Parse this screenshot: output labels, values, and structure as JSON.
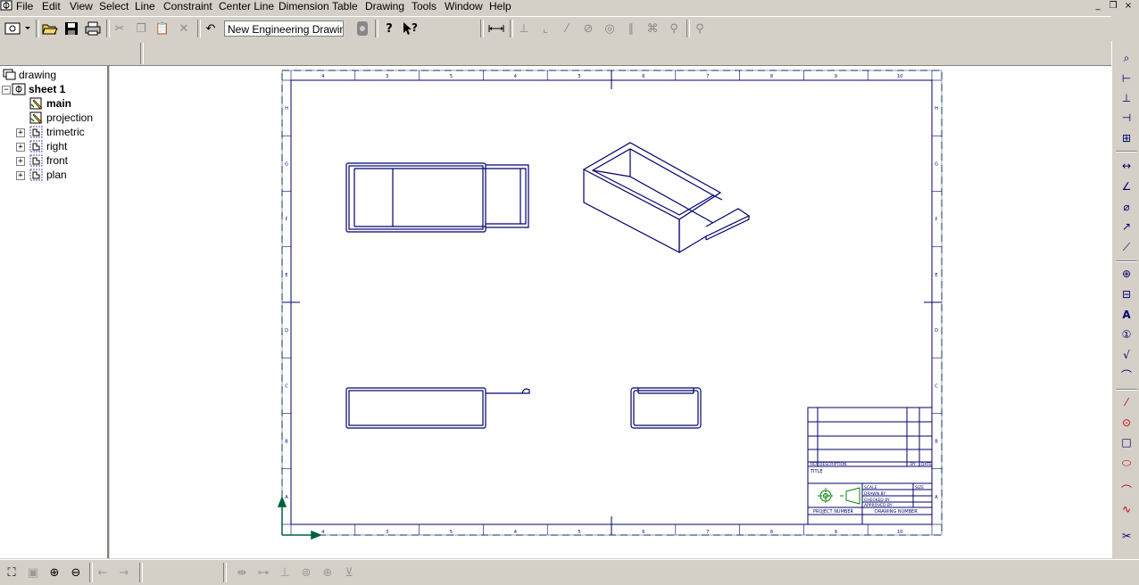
{
  "menu": {
    "items": [
      "File",
      "Edit",
      "View",
      "Select",
      "Line",
      "Constraint",
      "Center Line",
      "Dimension",
      "Table",
      "Drawing",
      "Tools",
      "Window",
      "Help"
    ],
    "window_controls": [
      "_",
      "❐",
      "×"
    ]
  },
  "toolbar": {
    "document_name": "New Engineering Drawing"
  },
  "tree": {
    "root": "drawing",
    "sheet": "sheet 1",
    "items": [
      {
        "label": "main",
        "bold": true,
        "icon": "view-pencil-icon",
        "expandable": false
      },
      {
        "label": "projection",
        "bold": false,
        "icon": "view-pencil-icon",
        "expandable": false
      },
      {
        "label": "trimetric",
        "bold": false,
        "icon": "view-frame-icon",
        "expandable": true
      },
      {
        "label": "right",
        "bold": false,
        "icon": "view-frame-icon",
        "expandable": true
      },
      {
        "label": "front",
        "bold": false,
        "icon": "view-frame-icon",
        "expandable": true
      },
      {
        "label": "plan",
        "bold": false,
        "icon": "view-frame-icon",
        "expandable": true
      }
    ]
  },
  "sheet": {
    "border_color": "#00006e",
    "axis_color": "#006040",
    "title_color": "#008000",
    "col_labels_top": [
      "4",
      "3",
      "5",
      "4",
      "5",
      "6",
      "7",
      "8",
      "9",
      "10"
    ],
    "col_labels_bottom": [
      "4",
      "3",
      "5",
      "4",
      "5",
      "6",
      "7",
      "8",
      "9",
      "10"
    ],
    "row_labels": [
      "H",
      "G",
      "F",
      "E",
      "D",
      "C",
      "B",
      "A"
    ],
    "title_block": {
      "title": "TITLE",
      "rev_row": [
        "REV",
        "DESCRIPTION",
        "BY",
        "DATE"
      ],
      "info_rows": [
        "SCALE",
        "DRAWN BY",
        "CHECKED BY",
        "APPROVED BY"
      ],
      "size_label": "SIZE",
      "project_number": "PROJECT NUMBER",
      "drawing_number": "DRAWING NUMBER"
    }
  },
  "status": {}
}
